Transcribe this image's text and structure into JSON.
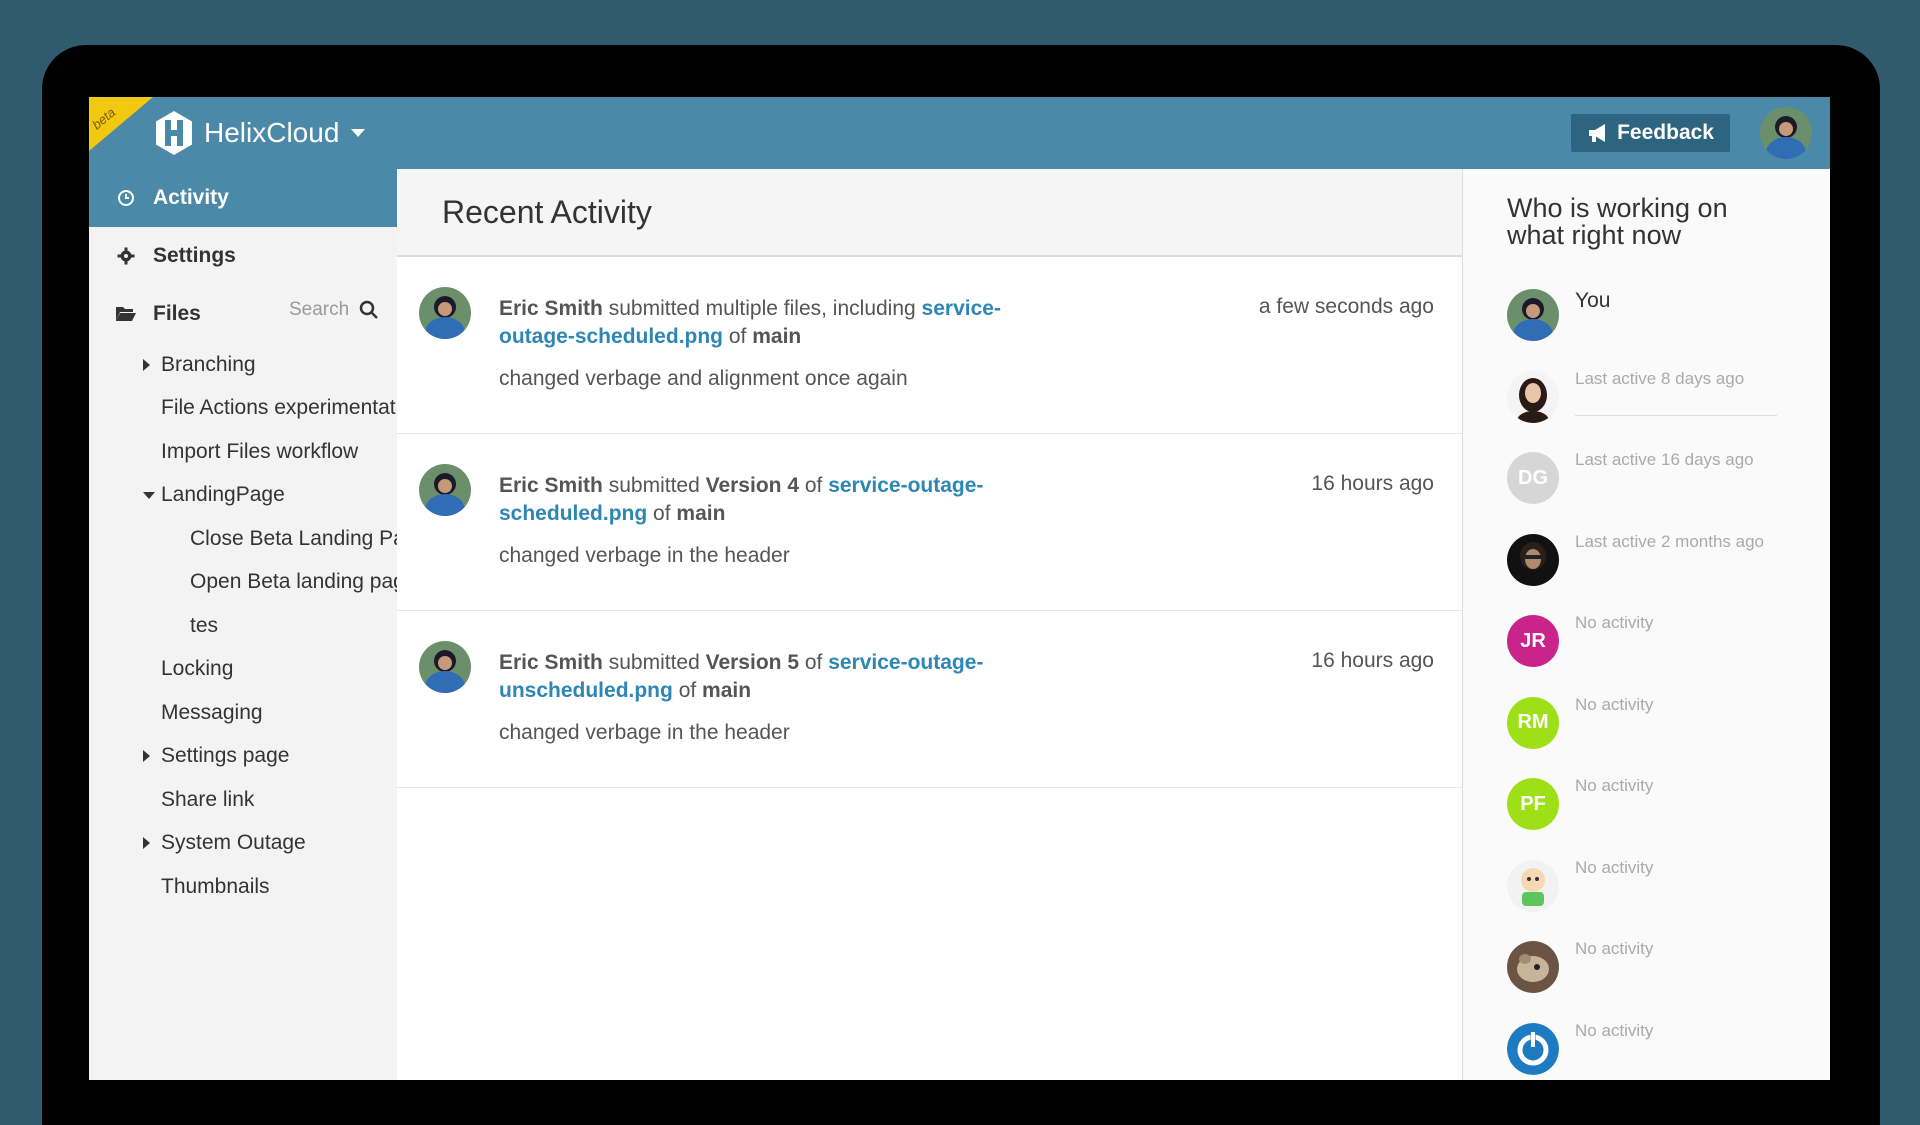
{
  "app": {
    "name": "HelixCloud",
    "beta": "beta",
    "feedback_label": "Feedback"
  },
  "sidebar": {
    "nav": [
      {
        "label": "Activity",
        "icon": "clock-icon",
        "active": true
      },
      {
        "label": "Settings",
        "icon": "gear-icon",
        "active": false
      }
    ],
    "files_label": "Files",
    "search_placeholder": "Search",
    "tree": [
      {
        "label": "Branching",
        "level": 1,
        "toggle": "collapsed"
      },
      {
        "label": "File Actions experimentation",
        "level": 1,
        "toggle": "none"
      },
      {
        "label": "Import Files workflow",
        "level": 1,
        "toggle": "none"
      },
      {
        "label": "LandingPage",
        "level": 1,
        "toggle": "expanded"
      },
      {
        "label": "Close Beta Landing Page",
        "level": 2,
        "toggle": "none"
      },
      {
        "label": "Open Beta landing page",
        "level": 2,
        "toggle": "none"
      },
      {
        "label": "tes",
        "level": 2,
        "toggle": "none"
      },
      {
        "label": "Locking",
        "level": 1,
        "toggle": "none"
      },
      {
        "label": "Messaging",
        "level": 1,
        "toggle": "none"
      },
      {
        "label": "Settings page",
        "level": 1,
        "toggle": "collapsed"
      },
      {
        "label": "Share link",
        "level": 1,
        "toggle": "none"
      },
      {
        "label": "System Outage",
        "level": 1,
        "toggle": "collapsed"
      },
      {
        "label": "Thumbnails",
        "level": 1,
        "toggle": "none"
      }
    ]
  },
  "main": {
    "title": "Recent Activity",
    "activities": [
      {
        "user": "Eric Smith",
        "action": "submitted multiple files, including",
        "version": "",
        "file_part1": "service-",
        "file_part2": "outage-scheduled.png",
        "of": "of",
        "branch": "main",
        "message": "changed verbage and alignment once again",
        "time": "a few seconds ago"
      },
      {
        "user": "Eric Smith",
        "action": "submitted",
        "version": "Version 4",
        "file_part1": "service-outage-",
        "file_part2": "scheduled.png",
        "of": "of",
        "branch": "main",
        "message": "changed verbage in the header",
        "time": "16 hours ago"
      },
      {
        "user": "Eric Smith",
        "action": "submitted",
        "version": "Version 5",
        "file_part1": "service-outage-",
        "file_part2": "unscheduled.png",
        "of": "of",
        "branch": "main",
        "message": "changed verbage in the header",
        "time": "16 hours ago"
      }
    ]
  },
  "right": {
    "title": "Who is working on what right now",
    "users": [
      {
        "label": "You",
        "kind": "photo-blue",
        "initials": ""
      },
      {
        "label": "Last active 8 days ago",
        "kind": "photo-woman",
        "initials": ""
      },
      {
        "label": "Last active 16 days ago",
        "kind": "initials",
        "initials": "DG",
        "color": "#d6d6d6"
      },
      {
        "label": "Last active 2 months ago",
        "kind": "photo-dark",
        "initials": ""
      },
      {
        "label": "No activity",
        "kind": "initials",
        "initials": "JR",
        "color": "#c8248a"
      },
      {
        "label": "No activity",
        "kind": "initials",
        "initials": "RM",
        "color": "#9ee018"
      },
      {
        "label": "No activity",
        "kind": "initials",
        "initials": "PF",
        "color": "#9ee018"
      },
      {
        "label": "No activity",
        "kind": "photo-cartoon",
        "initials": ""
      },
      {
        "label": "No activity",
        "kind": "photo-animal",
        "initials": ""
      },
      {
        "label": "No activity",
        "kind": "power-logo",
        "initials": ""
      }
    ]
  },
  "colors": {
    "topbar": "#4a8aa8",
    "link": "#2e86b4",
    "beta": "#f2c811"
  }
}
